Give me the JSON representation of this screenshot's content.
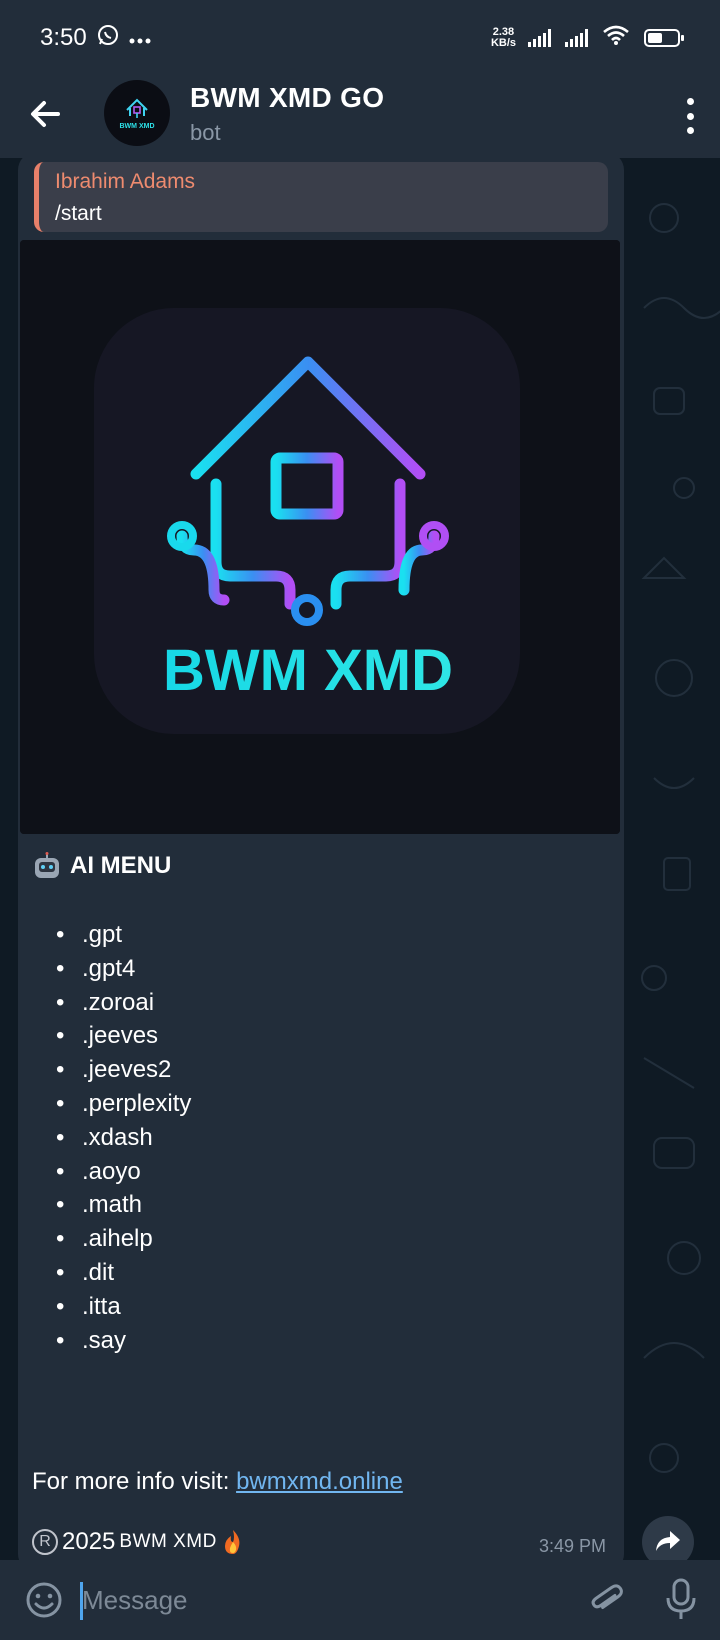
{
  "status_bar": {
    "time": "3:50",
    "icons": [
      "whatsapp-icon",
      "more-dots-icon"
    ],
    "net_speed_value": "2.38",
    "net_speed_unit": "KB/s"
  },
  "header": {
    "title": "BWM XMD GO",
    "subtitle": "bot",
    "avatar_text": "BWM XMD"
  },
  "message": {
    "reply": {
      "author": "Ibrahim Adams",
      "text": "/start"
    },
    "image_logo_text": "BWM XMD",
    "heading": "AI MENU",
    "commands": [
      ".gpt",
      ".gpt4",
      ".zoroai",
      ".jeeves",
      ".jeeves2",
      ".perplexity",
      ".xdash",
      ".aoyo",
      ".math",
      ".aihelp",
      ".dit",
      ".itta",
      ".say"
    ],
    "info_prefix": "For more info visit:",
    "info_link": "bwmxmd.online",
    "footer_year": "2025",
    "footer_brand": "BWM XMD",
    "time": "3:49 PM"
  },
  "composer": {
    "placeholder": "Message"
  },
  "colors": {
    "bar_bg": "#222d3a",
    "chat_bg": "#0f1a24",
    "reply_accent": "#ee8b6f",
    "link": "#71b6f0",
    "caret": "#4fa5ee"
  }
}
